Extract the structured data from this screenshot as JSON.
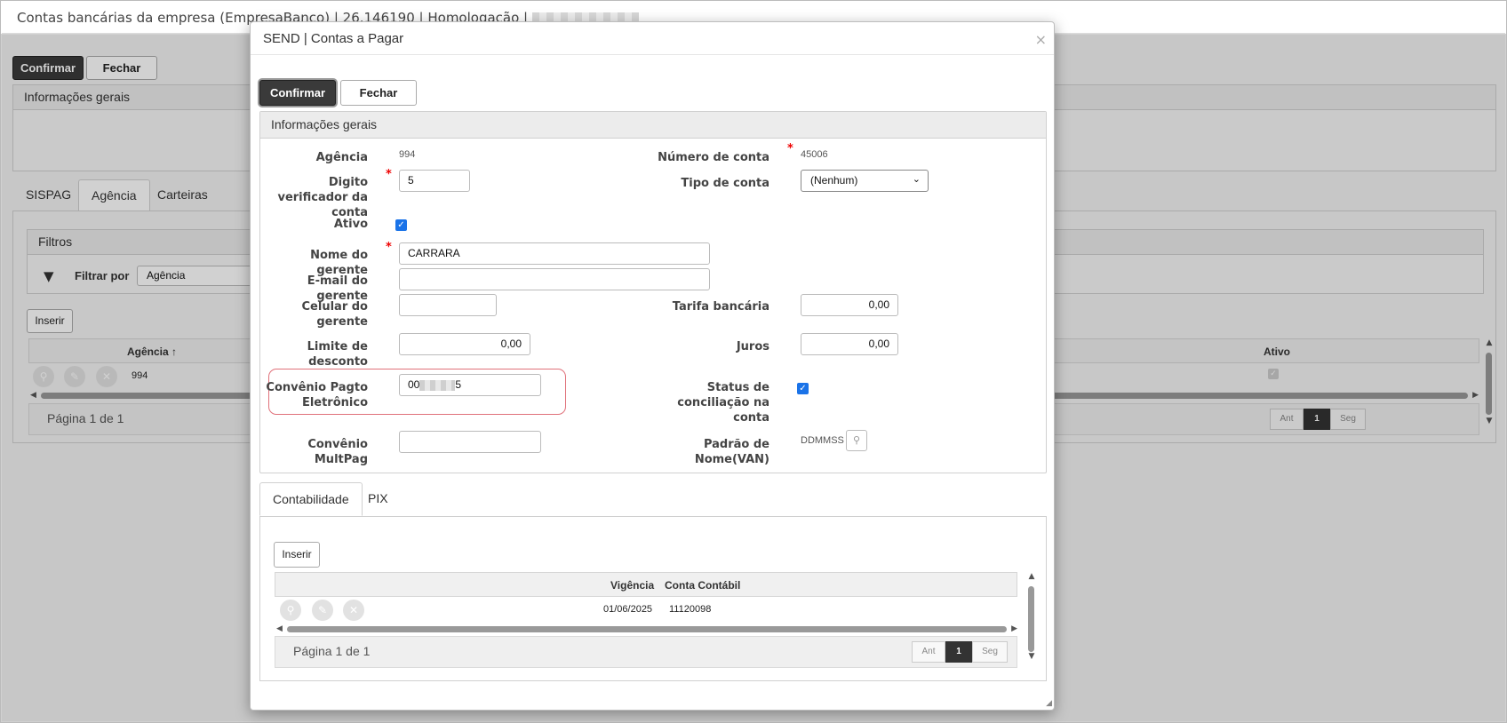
{
  "background": {
    "title_prefix": "Contas bancárias da empresa (EmpresaBanco) | 26.146190 | Homologação |",
    "confirm_label": "Confirmar",
    "close_label": "Fechar",
    "general_info_title": "Informações gerais",
    "tabs": [
      {
        "label": "SISPAG",
        "active": false
      },
      {
        "label": "Agência",
        "active": true
      },
      {
        "label": "Carteiras",
        "active": false
      }
    ],
    "filters_title": "Filtros",
    "filter_by_label": "Filtrar por",
    "filter_by_value": "Agência",
    "insert_label": "Inserir",
    "grid": {
      "columns": [
        "Agência ↑",
        "Ativo"
      ],
      "rows": [
        {
          "agencia": "994",
          "ativo": true
        }
      ]
    },
    "pager": {
      "text": "Página 1 de 1",
      "prev": "Ant",
      "current": "1",
      "next": "Seg"
    }
  },
  "modal": {
    "title": "SEND | Contas a Pagar",
    "close_glyph": "×",
    "confirm_label": "Confirmar",
    "close_label": "Fechar",
    "section_title": "Informações gerais",
    "fields": {
      "agencia": {
        "label": "Agência",
        "value": "994"
      },
      "numero_conta": {
        "label": "Número de conta",
        "value": "45006"
      },
      "digito": {
        "label": "Digito verificador da conta",
        "value": "5"
      },
      "tipo_conta": {
        "label": "Tipo de conta",
        "value": "(Nenhum)"
      },
      "ativo": {
        "label": "Ativo",
        "checked": true
      },
      "nome_gerente": {
        "label": "Nome do gerente",
        "value": "CARRARA"
      },
      "email_gerente": {
        "label": "E-mail do gerente",
        "value": ""
      },
      "celular_gerente": {
        "label": "Celular do gerente",
        "value": ""
      },
      "tarifa": {
        "label": "Tarifa bancária",
        "value": "0,00"
      },
      "limite_desconto": {
        "label": "Limite de desconto",
        "value": "0,00"
      },
      "juros": {
        "label": "Juros",
        "value": "0,00"
      },
      "convenio_pagto": {
        "label": "Convênio Pagto Eletrônico",
        "value_start": "00",
        "value_end": "5"
      },
      "status_conciliacao": {
        "label": "Status de conciliação na conta",
        "checked": true
      },
      "convenio_multpag": {
        "label": "Convênio MultPag",
        "value": ""
      },
      "padrao_nome": {
        "label": "Padrão de Nome(VAN)",
        "value": "DDMMSS"
      }
    },
    "tabs": [
      {
        "label": "Contabilidade",
        "active": true
      },
      {
        "label": "PIX",
        "active": false
      }
    ],
    "insert_label": "Inserir",
    "grid": {
      "columns": [
        "Vigência",
        "Conta Contábil"
      ],
      "rows": [
        {
          "vigencia": "01/06/2025",
          "conta": "11120098"
        }
      ]
    },
    "pager": {
      "text": "Página 1 de 1",
      "prev": "Ant",
      "current": "1",
      "next": "Seg"
    }
  },
  "icons": {
    "row_actions": [
      "search-icon",
      "edit-icon",
      "delete-icon"
    ],
    "filter": "filter-icon",
    "lookup": "search-icon"
  },
  "colors": {
    "primary_dark": "#3a3a3a",
    "checkbox": "#1a73e8",
    "required": "#e00000",
    "highlight": "#e0717a"
  }
}
